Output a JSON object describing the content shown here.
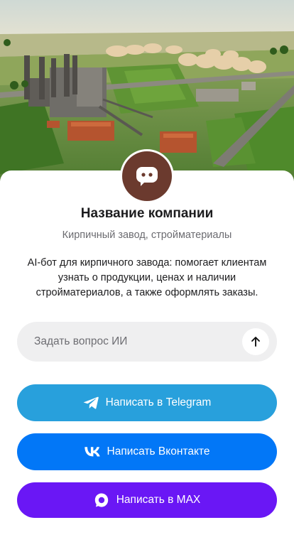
{
  "hero": {
    "image_icon": "brick-factory-aerial-photo"
  },
  "company": {
    "avatar_icon": "chat-bubble-icon",
    "avatar_color": "#6b3a2e",
    "name": "Название компании",
    "subtitle": "Кирпичный завод, стройматериалы",
    "description": "AI-бот для кирпичного завода: помогает клиентам узнать о продукции, ценах и наличии стройматериалов, а также оформлять заказы."
  },
  "ask": {
    "placeholder": "Задать вопрос ИИ",
    "value": "",
    "send_icon": "arrow-up-icon"
  },
  "buttons": {
    "telegram": {
      "label": "Написать в Telegram",
      "icon": "telegram-icon",
      "color": "#28a0dc"
    },
    "vk": {
      "label": "Написать Вконтакте",
      "icon": "vk-icon",
      "color": "#0277f7"
    },
    "max": {
      "label": "Написать в MAX",
      "icon": "max-icon",
      "color": "#6a17f5"
    }
  }
}
